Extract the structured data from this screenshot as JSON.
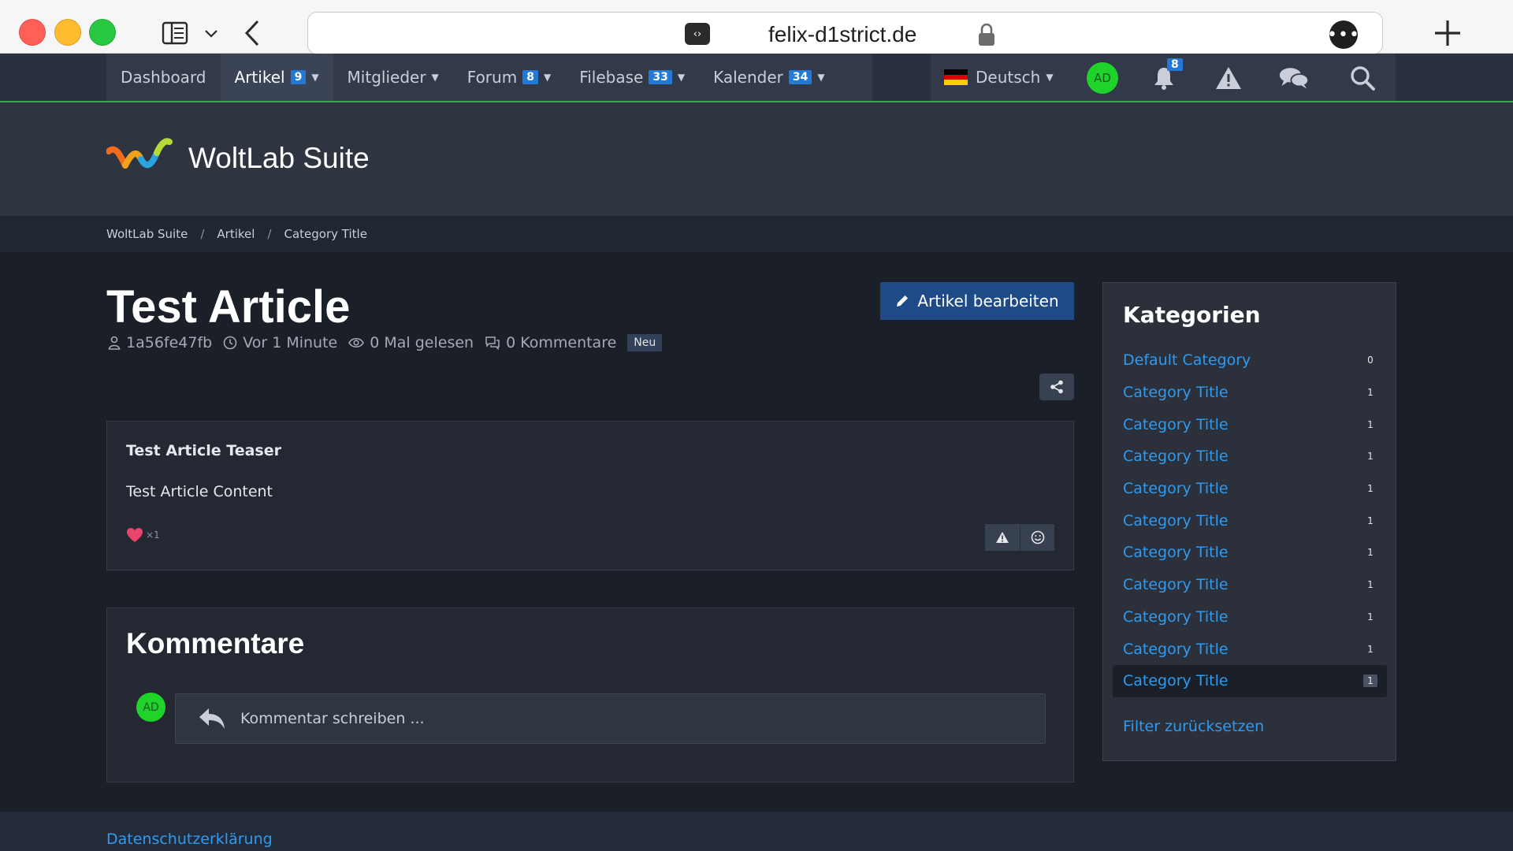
{
  "browser": {
    "url": "felix-d1strict.de",
    "url_icon": "code-icon"
  },
  "nav": {
    "items": [
      {
        "label": "Dashboard",
        "badge": "",
        "caret": false,
        "active": false
      },
      {
        "label": "Artikel",
        "badge": "9",
        "caret": true,
        "active": true
      },
      {
        "label": "Mitglieder",
        "badge": "",
        "caret": true,
        "active": false
      },
      {
        "label": "Forum",
        "badge": "8",
        "caret": true,
        "active": false
      },
      {
        "label": "Filebase",
        "badge": "33",
        "caret": true,
        "active": false
      },
      {
        "label": "Kalender",
        "badge": "34",
        "caret": true,
        "active": false
      }
    ],
    "language": "Deutsch",
    "avatar_initials": "AD",
    "notifications_count": "8"
  },
  "header": {
    "logo_text": "WoltLab Suite"
  },
  "breadcrumb": [
    "WoltLab Suite",
    "Artikel",
    "Category Title"
  ],
  "article": {
    "title": "Test Article",
    "author": "1a56fe47fb",
    "time": "Vor 1 Minute",
    "views": "0 Mal gelesen",
    "comments": "0 Kommentare",
    "badge": "Neu",
    "edit_label": "Artikel bearbeiten",
    "teaser": "Test Article Teaser",
    "content": "Test Article Content",
    "reaction_count": "×1"
  },
  "comments": {
    "title": "Kommentare",
    "avatar_initials": "AD",
    "placeholder": "Kommentar schreiben ..."
  },
  "sidebar": {
    "title": "Kategorien",
    "categories": [
      {
        "label": "Default Category",
        "count": "0",
        "active": false
      },
      {
        "label": "Category Title",
        "count": "1",
        "active": false
      },
      {
        "label": "Category Title",
        "count": "1",
        "active": false
      },
      {
        "label": "Category Title",
        "count": "1",
        "active": false
      },
      {
        "label": "Category Title",
        "count": "1",
        "active": false
      },
      {
        "label": "Category Title",
        "count": "1",
        "active": false
      },
      {
        "label": "Category Title",
        "count": "1",
        "active": false
      },
      {
        "label": "Category Title",
        "count": "1",
        "active": false
      },
      {
        "label": "Category Title",
        "count": "1",
        "active": false
      },
      {
        "label": "Category Title",
        "count": "1",
        "active": false
      },
      {
        "label": "Category Title",
        "count": "1",
        "active": true
      }
    ],
    "filter_reset": "Filter zurücksetzen"
  },
  "footer": {
    "privacy": "Datenschutzerklärung"
  },
  "colors": {
    "accent": "#2379d8",
    "link": "#2f9bf0",
    "online_green": "#1fd32a",
    "reaction": "#e8456b"
  }
}
